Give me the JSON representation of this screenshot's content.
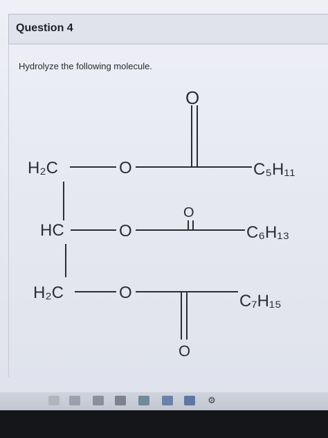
{
  "question": {
    "title": "Question 4",
    "prompt": "Hydrolyze the following molecule."
  },
  "molecule": {
    "row1": {
      "carbon": "H₂C",
      "oxygen": "O",
      "carbonyl_oxygen": "O",
      "chain": "C₅H₁₁"
    },
    "row2": {
      "carbon": "HC",
      "oxygen": "O",
      "carbonyl_oxygen": "O",
      "chain": "C₆H₁₃"
    },
    "row3": {
      "carbon": "H₂C",
      "oxygen": "O",
      "carbonyl_oxygen": "O",
      "chain": "C₇H₁₅"
    }
  },
  "taskbar": {
    "icons": [
      "down-arrow-icon",
      "task-view-icon",
      "folder-icon",
      "store-icon",
      "mail-icon",
      "app-icon",
      "photos-icon",
      "settings-icon"
    ]
  }
}
